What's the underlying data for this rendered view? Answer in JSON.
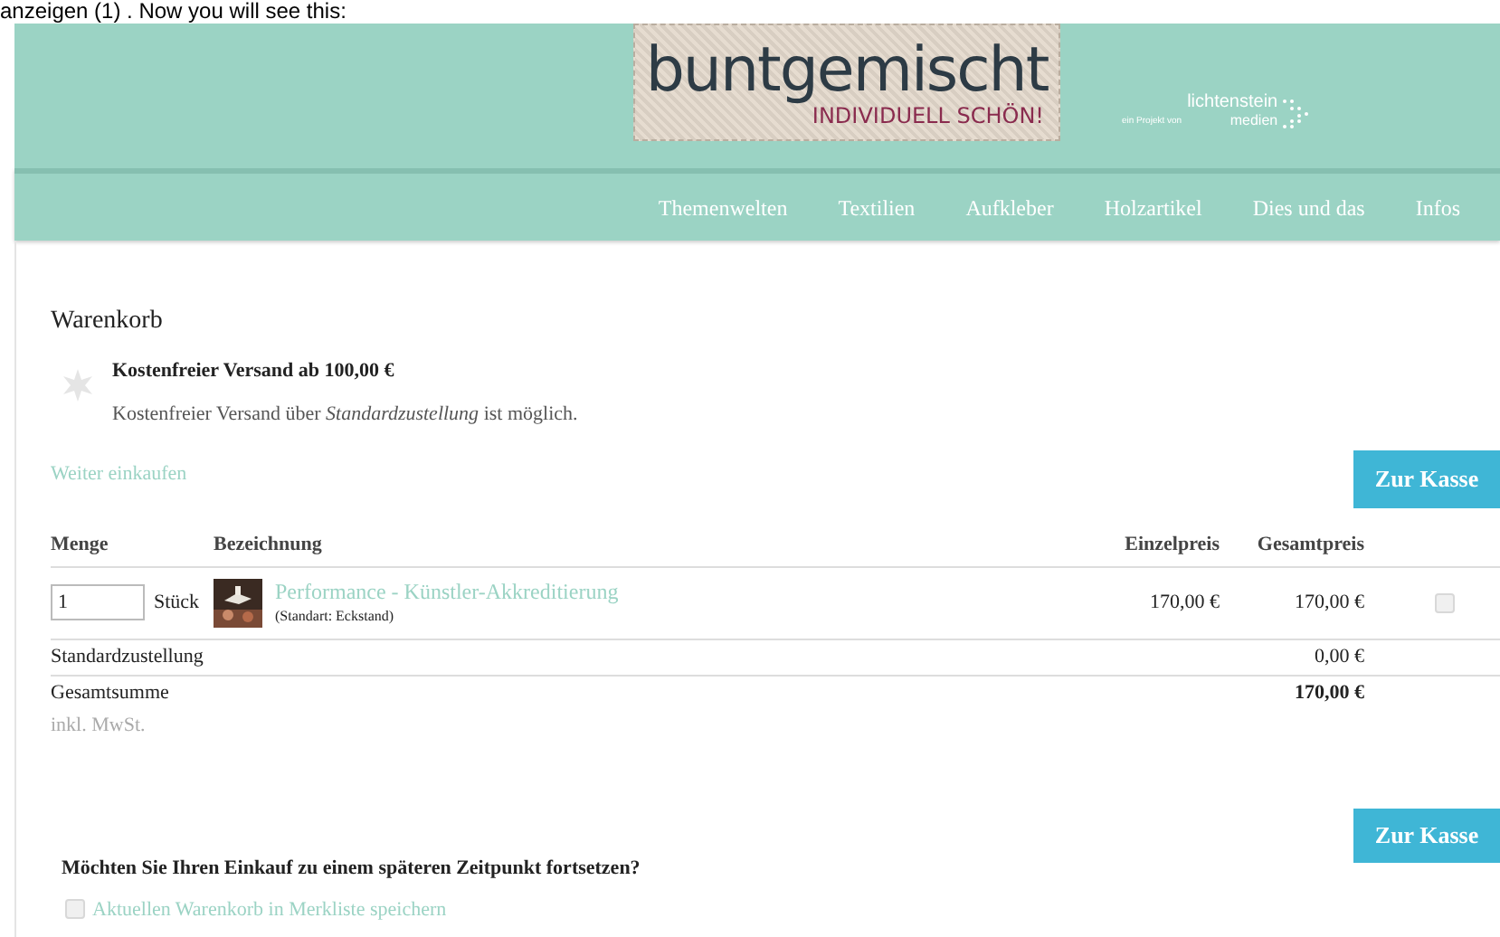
{
  "caption": "anzeigen (1) . Now you will see this:",
  "header": {
    "logo_title": "buntgemischt",
    "logo_tagline": "INDIVIDUELL SCHÖN!",
    "partner_prefix": "ein Projekt von",
    "partner_name": "lichtenstein",
    "partner_sub": "medien"
  },
  "nav": [
    {
      "label": "Themenwelten"
    },
    {
      "label": "Textilien"
    },
    {
      "label": "Aufkleber"
    },
    {
      "label": "Holzartikel"
    },
    {
      "label": "Dies und das"
    },
    {
      "label": "Infos"
    }
  ],
  "cart": {
    "title": "Warenkorb",
    "notice_title": "Kostenfreier Versand ab 100,00 €",
    "notice_text": "Kostenfreier Versand über *Standardzustellung* ist möglich.",
    "continue_link": "Weiter einkaufen",
    "checkout_button": "Zur Kasse",
    "columns": [
      "Menge",
      "Bezeichnung",
      "Einzelpreis",
      "Gesamtpreis"
    ],
    "items": [
      {
        "quantity": "1",
        "unit": "Stück",
        "name": "Performance - Künstler-Akkreditierung",
        "variant": "(Standart: Eckstand)",
        "unit_price": "170,00 €",
        "total_price": "170,00 €",
        "checked": false
      }
    ],
    "shipping": {
      "label": "Standardzustellung",
      "value": "0,00 €"
    },
    "total": {
      "label": "Gesamtsumme",
      "value": "170,00 €",
      "note": "inkl. MwSt."
    },
    "checkout_button_bottom": "Zur Kasse",
    "save_question": "Möchten Sie Ihren Einkauf zu einem späteren Zeitpunkt fortsetzen?",
    "save_option": {
      "label": "Aktuellen Warenkorb in Merkliste speichern",
      "checked": false
    }
  }
}
